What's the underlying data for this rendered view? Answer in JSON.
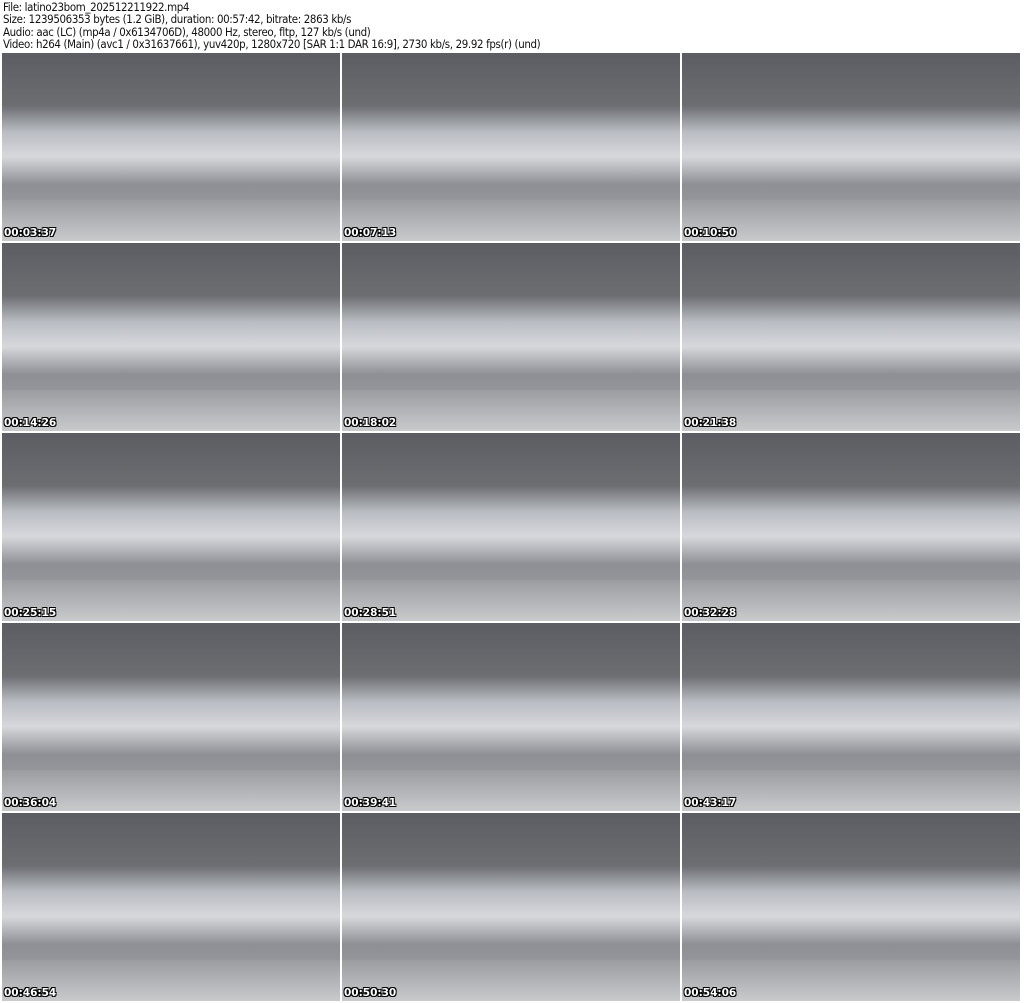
{
  "info": {
    "file": "File: latino23bom_202512211922.mp4",
    "size": "Size: 1239506353 bytes (1.2 GiB), duration: 00:57:42, bitrate: 2863 kb/s",
    "audio": "Audio: aac (LC) (mp4a / 0x6134706D), 48000 Hz, stereo, fltp, 127 kb/s (und)",
    "video": "Video: h264 (Main) (avc1 / 0x31637661), yuv420p, 1280x720 [SAR 1:1 DAR 16:9], 2730 kb/s, 29.92 fps(r) (und)"
  },
  "thumbnails": [
    {
      "timestamp": "00:03:37"
    },
    {
      "timestamp": "00:07:13"
    },
    {
      "timestamp": "00:10:50"
    },
    {
      "timestamp": "00:14:26"
    },
    {
      "timestamp": "00:18:02"
    },
    {
      "timestamp": "00:21:38"
    },
    {
      "timestamp": "00:25:15"
    },
    {
      "timestamp": "00:28:51"
    },
    {
      "timestamp": "00:32:28"
    },
    {
      "timestamp": "00:36:04"
    },
    {
      "timestamp": "00:39:41"
    },
    {
      "timestamp": "00:43:17"
    },
    {
      "timestamp": "00:46:54"
    },
    {
      "timestamp": "00:50:30"
    },
    {
      "timestamp": "00:54:06"
    }
  ]
}
